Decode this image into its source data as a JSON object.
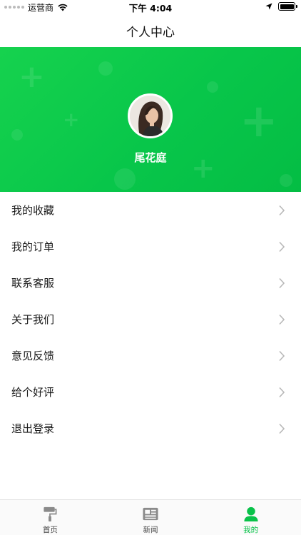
{
  "status_bar": {
    "carrier": "运营商",
    "time": "下午 4:04"
  },
  "nav": {
    "title": "个人中心"
  },
  "profile": {
    "username": "尾花庭"
  },
  "menu": [
    {
      "label": "我的收藏",
      "icon": "chevron-right-icon"
    },
    {
      "label": "我的订单",
      "icon": "chevron-right-icon"
    },
    {
      "label": "联系客服",
      "icon": "chevron-right-icon"
    },
    {
      "label": "关于我们",
      "icon": "chevron-right-icon"
    },
    {
      "label": "意见反馈",
      "icon": "chevron-right-icon"
    },
    {
      "label": "给个好评",
      "icon": "chevron-right-icon"
    },
    {
      "label": "退出登录",
      "icon": "chevron-right-icon"
    }
  ],
  "tabbar": [
    {
      "label": "首页",
      "icon": "paint-roller-icon",
      "active": false
    },
    {
      "label": "新闻",
      "icon": "newspaper-icon",
      "active": false
    },
    {
      "label": "我的",
      "icon": "user-icon",
      "active": true
    }
  ],
  "colors": {
    "accent": "#09c24a",
    "header_bg": "#0bc84b",
    "tab_inactive": "#8a8a8a"
  }
}
